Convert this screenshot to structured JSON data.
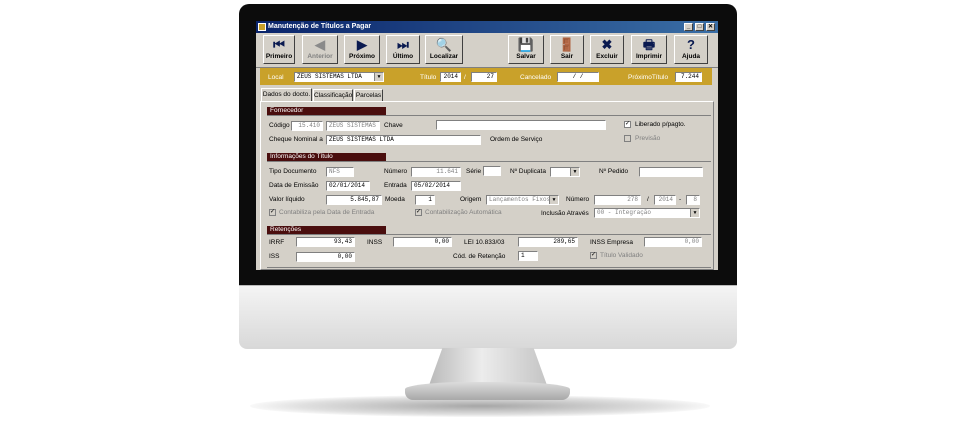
{
  "window": {
    "title": "Manutenção de Títulos a Pagar"
  },
  "toolbar": {
    "buttons": [
      {
        "label": "Primeiro",
        "icon": "first-record-icon",
        "glyph": "⏮",
        "enabled": true
      },
      {
        "label": "Anterior",
        "icon": "previous-record-icon",
        "glyph": "◀",
        "enabled": false
      },
      {
        "label": "Próximo",
        "icon": "next-record-icon",
        "glyph": "▶",
        "enabled": true
      },
      {
        "label": "Último",
        "icon": "last-record-icon",
        "glyph": "⏭",
        "enabled": true
      },
      {
        "label": "Localizar",
        "icon": "search-icon",
        "glyph": "🔍",
        "enabled": true
      },
      {
        "label": "Salvar",
        "icon": "save-icon",
        "glyph": "💾",
        "enabled": true
      },
      {
        "label": "Sair",
        "icon": "exit-door-icon",
        "glyph": "🚪",
        "enabled": true
      },
      {
        "label": "Excluir",
        "icon": "delete-document-icon",
        "glyph": "✖",
        "enabled": true
      },
      {
        "label": "Imprimir",
        "icon": "printer-icon",
        "glyph": "🖶",
        "enabled": true
      },
      {
        "label": "Ajuda",
        "icon": "help-icon",
        "glyph": "?",
        "enabled": true
      }
    ]
  },
  "header": {
    "local_label": "Local",
    "local_value": "ZEUS SISTEMAS LTDA",
    "titulo_label": "Título",
    "titulo_year": "2014",
    "titulo_sep": "/",
    "titulo_number": "27",
    "cancelado_label": "Cancelado",
    "cancelado_value": "/   /",
    "proximo_label": "PróximoTítulo",
    "proximo_value": "7.244"
  },
  "tabs": [
    "Dados do docto.",
    "Classificação",
    "Parcelas"
  ],
  "fornecedor": {
    "section_title": "Fornecedor",
    "codigo_label": "Código",
    "codigo_value": "15.410",
    "nome_value": "ZEUS SISTEMAS LTDA",
    "chave_label": "Chave",
    "chave_value": "",
    "liberado_label": "Liberado p/pagto.",
    "cheque_label": "Cheque Nominal a",
    "cheque_value": "ZEUS SISTEMAS LTDA",
    "ordem_label": "Ordem de Serviço",
    "previsao_label": "Previsão"
  },
  "informacoes": {
    "section_title": "Informações do Título",
    "tipo_label": "Tipo Documento",
    "tipo_value": "NFS",
    "numero_label": "Número",
    "numero_value": "11.641",
    "serie_label": "Série",
    "serie_value": "",
    "nduplicata_label": "Nº Duplicata",
    "nduplicata_value": "",
    "npedido_label": "Nº Pedido",
    "npedido_value": "",
    "emissao_label": "Data de Emissão",
    "emissao_value": "02/01/2014",
    "entrada_label": "Entrada",
    "entrada_value": "05/02/2014",
    "valor_label": "Valor líquido",
    "valor_value": "5.845,87",
    "moeda_label": "Moeda",
    "moeda_value": "1",
    "origem_label": "Origem",
    "origem_value": "Lançamentos Fixos",
    "numero2_label": "Número",
    "numero2_value": "278",
    "numero2_sep": "/",
    "numero2_year": "2014",
    "numero2_dash": "-",
    "numero2_seq": "8",
    "contabiliza_label": "Contabiliza pela Data de Entrada",
    "contab_auto_label": "Contabilização Automática",
    "inclusao_label": "Inclusão Através",
    "inclusao_value": "00 - Integração"
  },
  "retencoes": {
    "section_title": "Retenções",
    "irrf_label": "IRRF",
    "irrf_value": "93,43",
    "inss_label": "INSS",
    "inss_value": "0,00",
    "lei_label": "LEI 10.833/03",
    "lei_value": "289,65",
    "inss_emp_label": "INSS Empresa",
    "inss_emp_value": "0,00",
    "iss_label": "ISS",
    "iss_value": "0,00",
    "cod_label": "Cód. de Retenção",
    "cod_value": "1",
    "validado_label": "Título Validado"
  }
}
